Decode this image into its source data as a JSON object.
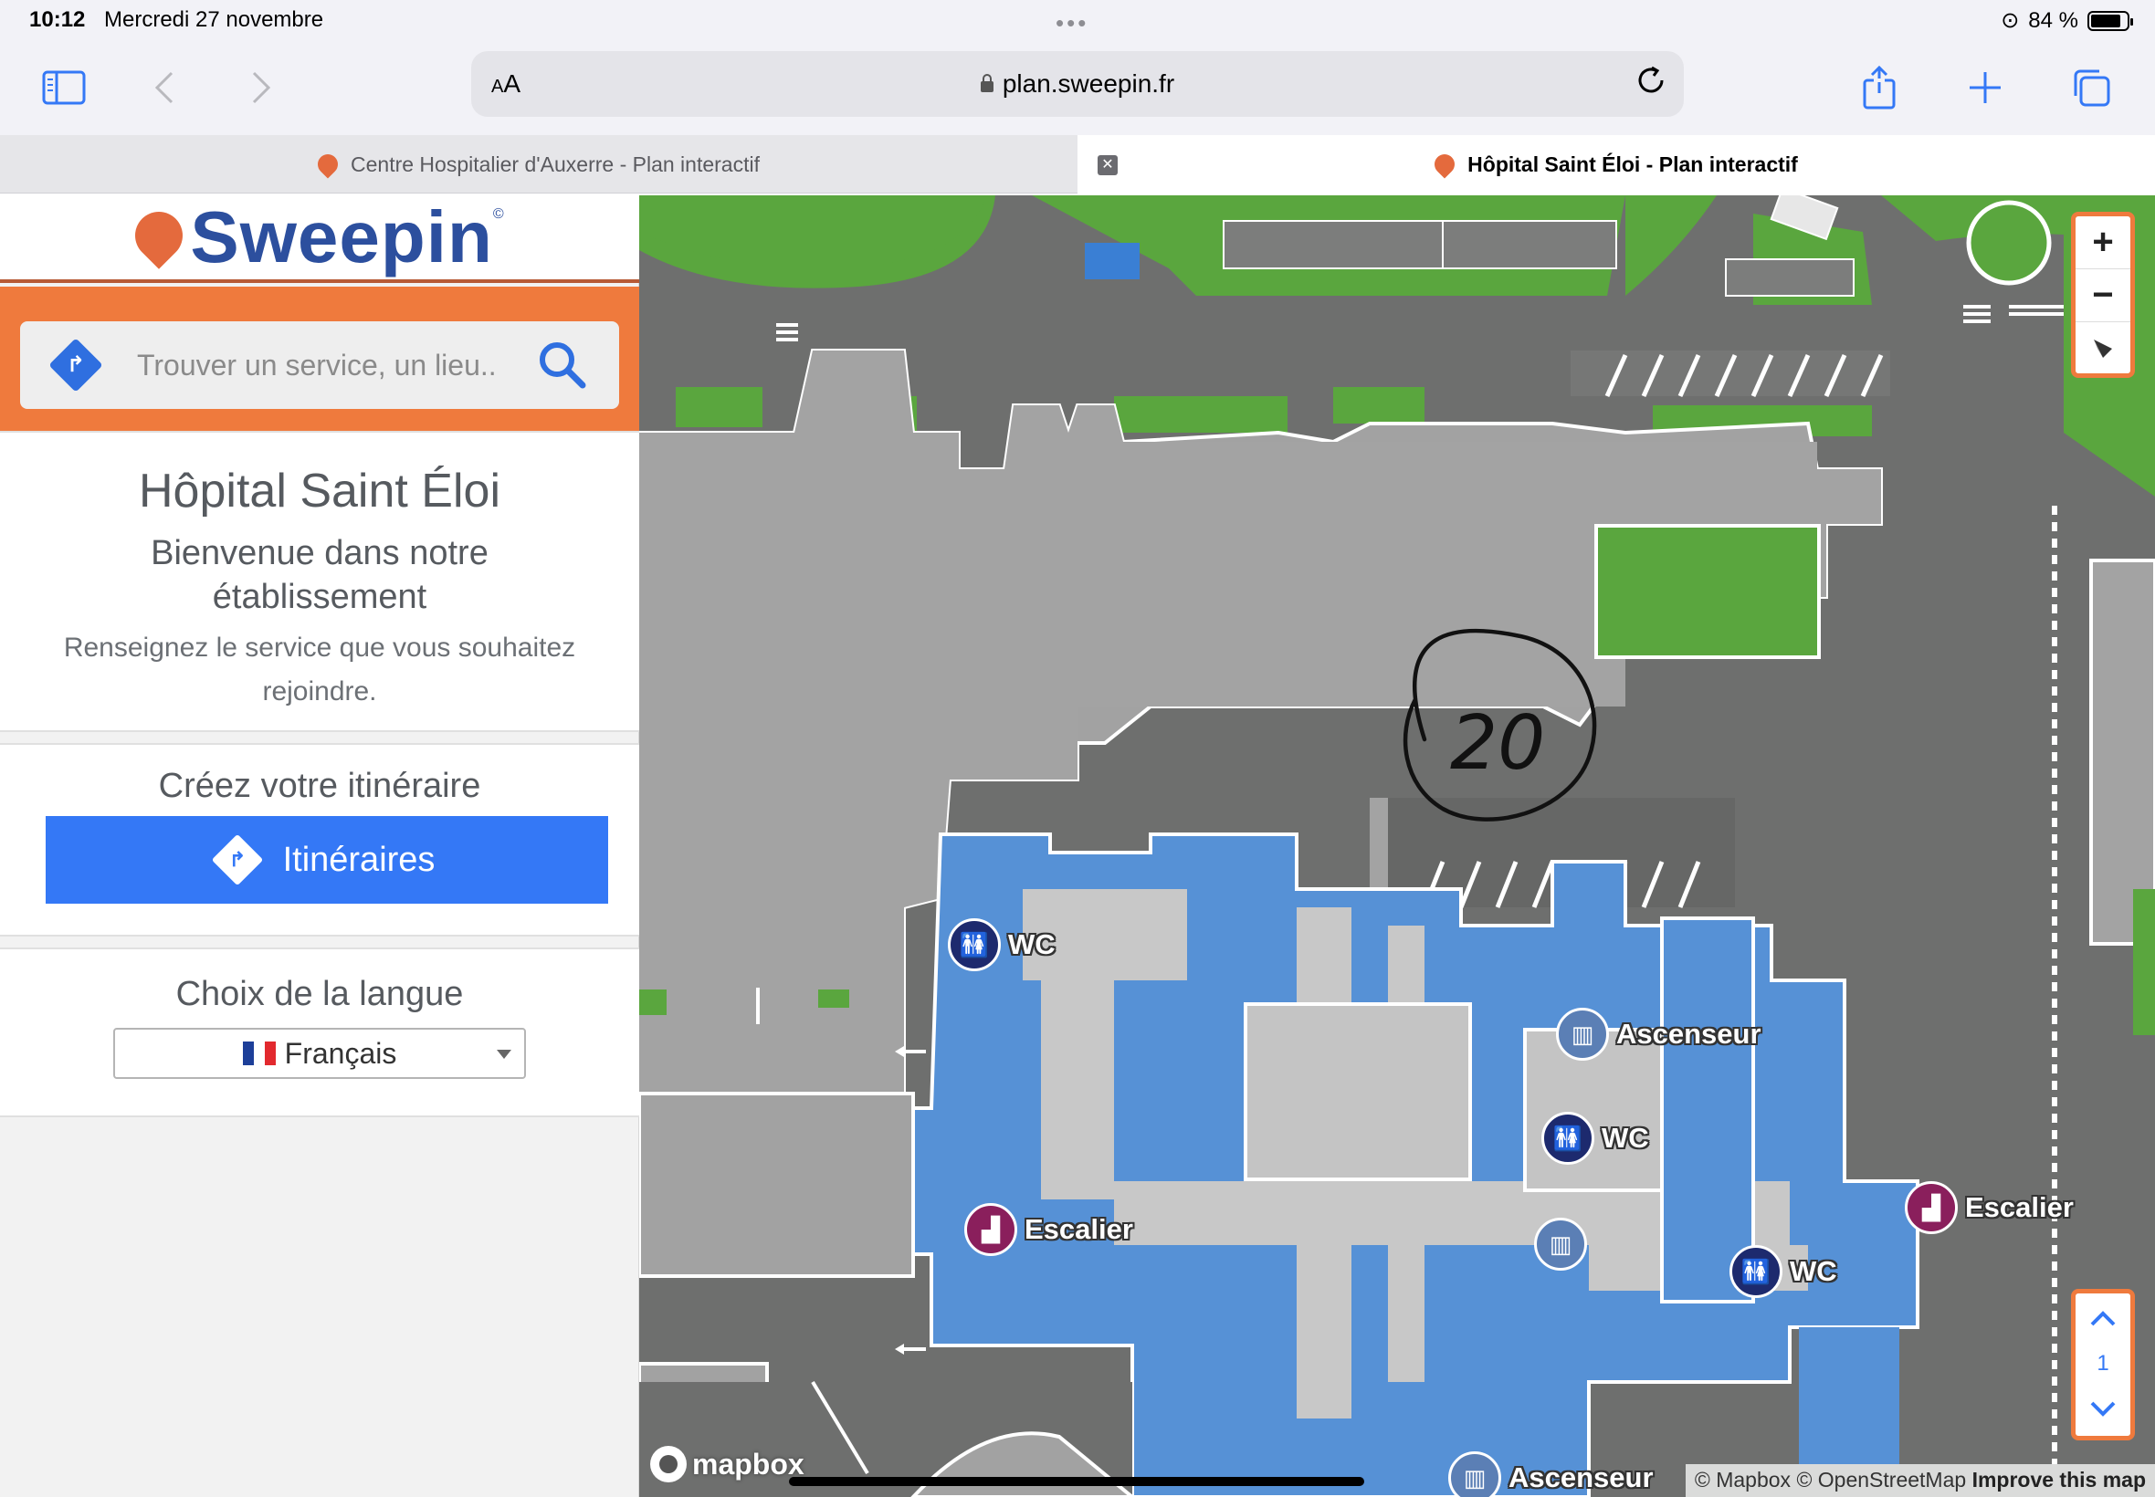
{
  "status": {
    "time": "10:12",
    "date": "Mercredi 27 novembre",
    "battery": "84 %",
    "battery_level": 0.84
  },
  "browser": {
    "text_size_label": "AA",
    "url": "plan.sweepin.fr",
    "tabs": [
      {
        "title": "Centre Hospitalier d'Auxerre - Plan interactif",
        "active": false
      },
      {
        "title": "Hôpital Saint Éloi - Plan interactif",
        "active": true
      }
    ],
    "icons": [
      "sidebar-icon",
      "back-icon",
      "forward-icon",
      "reload-icon",
      "share-icon",
      "new-tab-icon",
      "tabs-overview-icon"
    ]
  },
  "sidebar": {
    "logo_text": "Sweepin",
    "logo_mark": "©",
    "search_placeholder": "Trouver un service, un lieu..",
    "hospital_name": "Hôpital Saint Éloi",
    "welcome_title": "Bienvenue dans notre établissement",
    "welcome_text": "Renseignez le service que vous souhaitez rejoindre.",
    "itinerary_title": "Créez votre itinéraire",
    "itinerary_button": "Itinéraires",
    "language_title": "Choix de la langue",
    "language_selected": "Français"
  },
  "map": {
    "annotation": "20",
    "pois": [
      {
        "type": "wc",
        "label": "WC"
      },
      {
        "type": "stairs",
        "label": "Escalier"
      },
      {
        "type": "lift",
        "label": "Ascenseur"
      },
      {
        "type": "wc",
        "label": "WC"
      },
      {
        "type": "stairs",
        "label": "Escalier"
      },
      {
        "type": "lift",
        "label": ""
      },
      {
        "type": "wc",
        "label": "WC"
      },
      {
        "type": "lift",
        "label": "Ascenseur"
      }
    ],
    "controls": {
      "zoom_in": "+",
      "zoom_out": "−",
      "floor": "1"
    },
    "mapbox_label": "mapbox",
    "attribution": {
      "mapbox": "© Mapbox",
      "osm": "© OpenStreetMap",
      "improve": "Improve this map"
    }
  },
  "colors": {
    "accent": "#3478f6",
    "brand_orange": "#ef7a3d",
    "brand_blue": "#2c4f9e",
    "building": "#5691d6",
    "grass": "#5aa63e"
  }
}
